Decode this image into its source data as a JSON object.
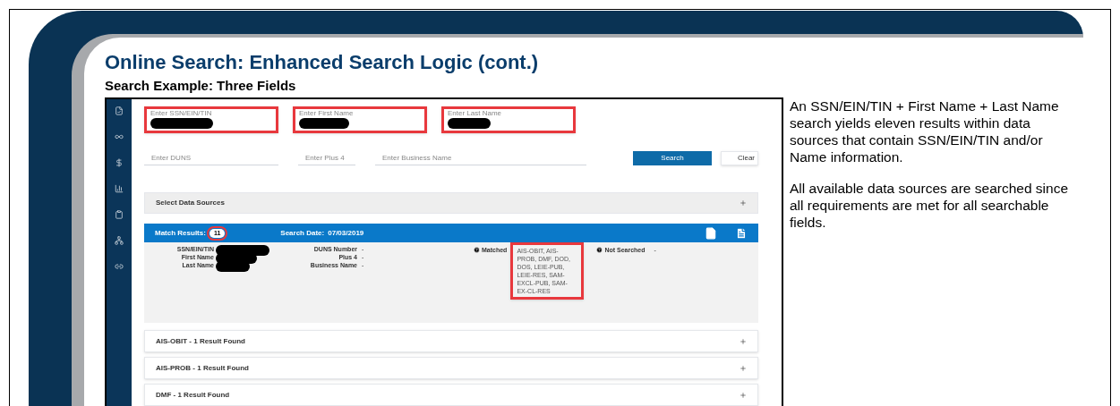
{
  "slide": {
    "title": "Online Search: Enhanced Search Logic (cont.)",
    "subtitle": "Search Example: Three Fields",
    "notes": [
      "An SSN/EIN/TIN + First Name + Last Name search yields eleven results within data sources that contain SSN/EIN/TIN and/or Name information.",
      "All available data sources are searched since all requirements are met for all searchable fields."
    ]
  },
  "app": {
    "name_fields": [
      {
        "label": "Enter SSN/EIN/TIN",
        "highlighted": true
      },
      {
        "label": "Enter First Name",
        "highlighted": true
      },
      {
        "label": "Enter Last Name",
        "highlighted": true
      }
    ],
    "other_fields": [
      {
        "placeholder": "Enter DUNS"
      },
      {
        "placeholder": "Enter Plus 4"
      },
      {
        "placeholder": "Enter Business Name"
      }
    ],
    "buttons": [
      {
        "label": "Search",
        "kind": "primary"
      },
      {
        "label": "Clear",
        "kind": "secondary"
      }
    ],
    "data_sources": {
      "title": "Select Data Sources",
      "expanded": false
    },
    "match_bar": {
      "label": "Match Results:",
      "count": "11",
      "count_highlighted": true,
      "date_label": "Search Date:",
      "date": "07/03/2019"
    },
    "person_details": [
      {
        "label": "SSN/EIN/TIN"
      },
      {
        "label": "First Name"
      },
      {
        "label": "Last Name"
      }
    ],
    "business_details": [
      {
        "label": "DUNS Number",
        "value": "-"
      },
      {
        "label": "Plus 4",
        "value": "-"
      },
      {
        "label": "Business Name",
        "value": "-"
      }
    ],
    "matched": {
      "label": "Matched",
      "value": "AIS-OBIT, AIS-PROB, DMF, DOD, DOS, LEIE-PUB, LEIE-RES, SAM-EXCL-PUB, SAM-EX-CL-RES",
      "highlighted": true
    },
    "not_searched": {
      "label": "Not Searched",
      "value": "-"
    },
    "results": [
      {
        "title": "AIS-OBIT - 1 Result Found",
        "expanded": false
      },
      {
        "title": "AIS-PROB - 1 Result Found",
        "expanded": false
      },
      {
        "title": "DMF - 1 Result Found",
        "expanded": false
      }
    ]
  }
}
